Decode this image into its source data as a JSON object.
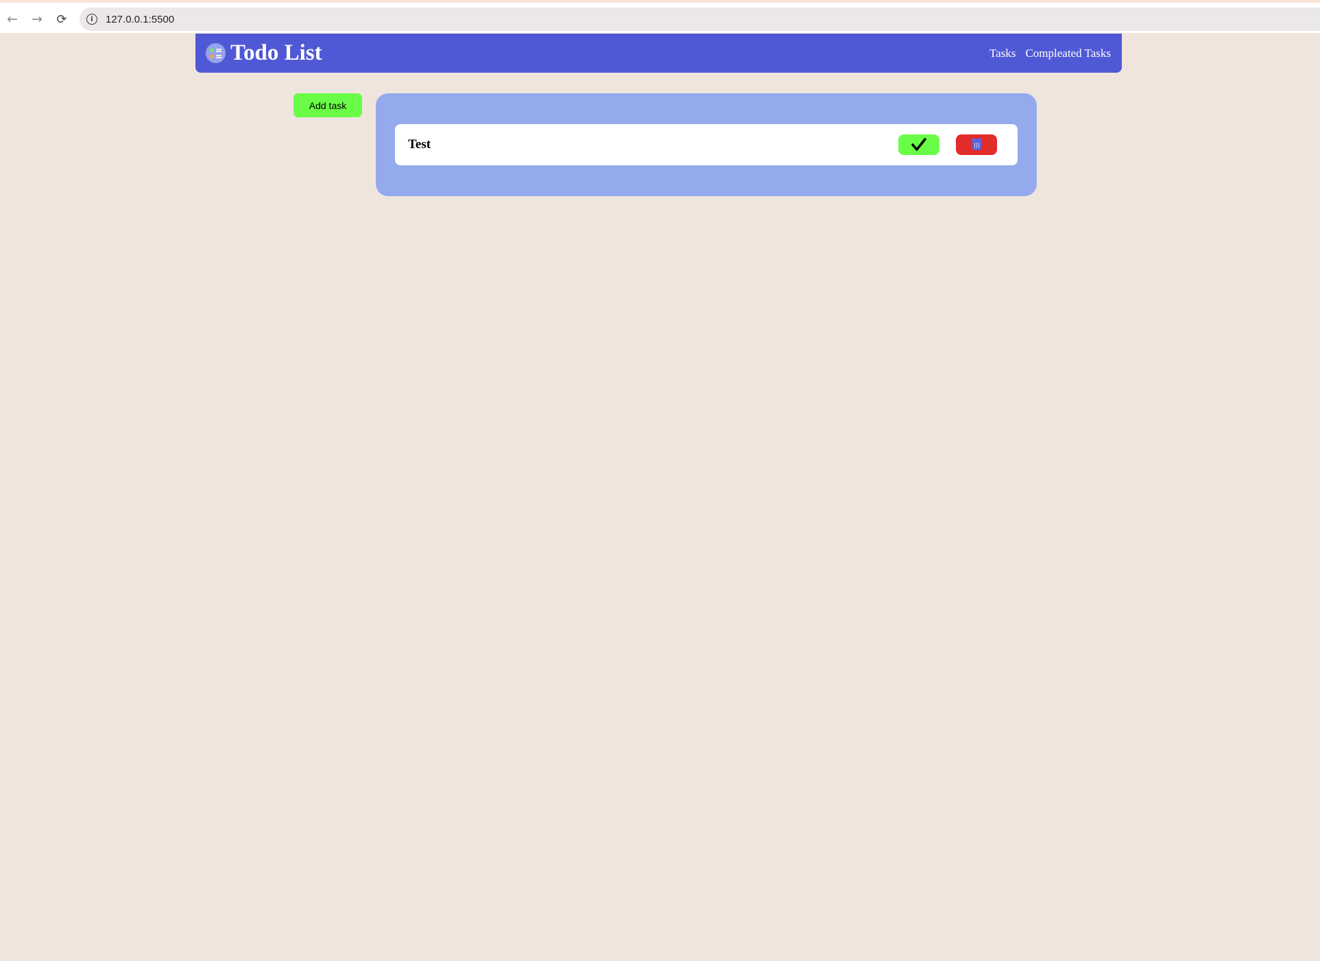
{
  "browser": {
    "url": "127.0.0.1:5500"
  },
  "header": {
    "title": "Todo List",
    "nav": {
      "tasks": "Tasks",
      "completed": "Compleated Tasks"
    }
  },
  "main": {
    "add_task_label": "Add task",
    "tasks": [
      {
        "name": "Test"
      }
    ]
  },
  "colors": {
    "header_bg": "#5059d5",
    "page_bg": "#efe5dd",
    "panel_bg": "#95aaed",
    "complete_btn": "#6afd47",
    "delete_btn": "#e22b2b"
  },
  "icons": {
    "complete": "check-icon",
    "delete": "trash-icon",
    "logo": "todo-list-logo-icon"
  }
}
